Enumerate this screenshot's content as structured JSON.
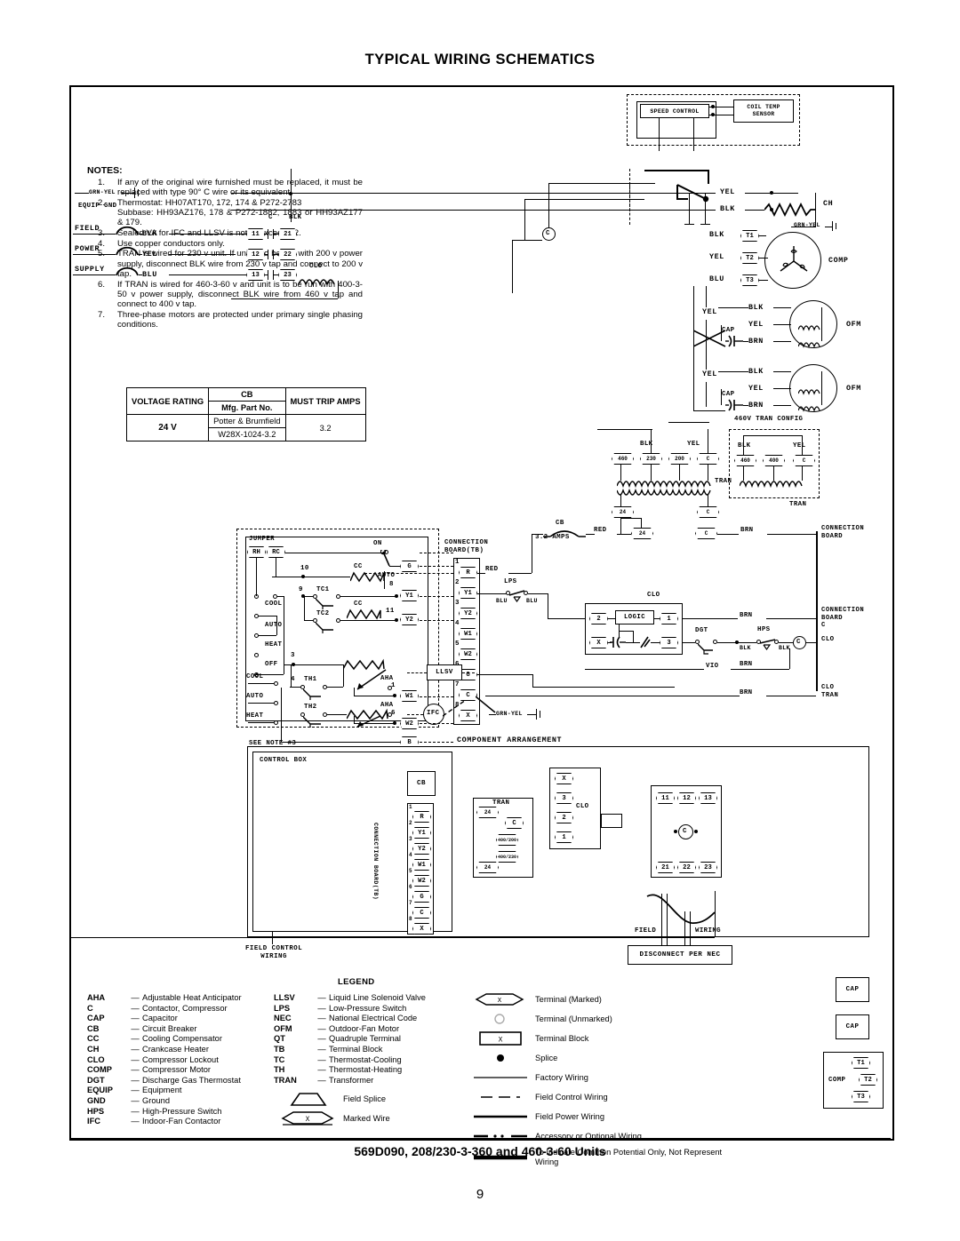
{
  "page_title": "TYPICAL WIRING SCHEMATICS",
  "footer_title": "569D090, 208/230-3-360 and 460-3-60 Units",
  "page_number": "9",
  "notes": {
    "heading": "NOTES:",
    "items": [
      {
        "num": "1.",
        "text": "If any of the original wire furnished must be replaced, it must be replaced with type 90° C wire or its equivalent."
      },
      {
        "num": "2.",
        "text": "Thermostat: HH07AT170, 172, 174 & P272-2783",
        "sub": "Subbase: HH93AZ176, 178 & P272-1882, 1883 or HH93AZ177 & 179."
      },
      {
        "num": "3.",
        "text": "Sealed VA for IFC and LLSV is not to exceed 22."
      },
      {
        "num": "4.",
        "text": "Use copper conductors only."
      },
      {
        "num": "5.",
        "text": "TRAN is wired for 230 v unit. If unit is to be run with 200 v power supply, disconnect BLK wire from 230 v tap and connect to 200 v tap."
      },
      {
        "num": "6.",
        "text": "If TRAN is wired for 460-3-60 v and unit is to be run with 400-3-50 v power supply, disconnect BLK wire from 460 v tap and connect to 400 v tap."
      },
      {
        "num": "7.",
        "text": "Three-phase motors are protected under primary single phasing conditions."
      }
    ]
  },
  "cb_table": {
    "col1_header": "VOLTAGE RATING",
    "col2_header": "CB",
    "col2_subheader": "Mfg. Part No.",
    "col3_header": "MUST TRIP AMPS",
    "voltage_value": "24 V",
    "mfg_name": "Potter & Brumfield",
    "mfg_part": "W28X-1024-3.2",
    "trip_amps": "3.2"
  },
  "schematic": {
    "speed_control": "SPEED CONTROL",
    "coil_temp_sensor": "COIL TEMP\nSENSOR",
    "equip_gnd": "EQUIP GND",
    "grn_yel": "GRN-YEL",
    "field": "FIELD",
    "power": "POWER",
    "supply": "SUPPLY",
    "ch": "CH",
    "comp": "COMP",
    "ofm": "OFM",
    "cap": "CAP",
    "tran": "TRAN",
    "tran_config_460": "460V TRAN CONFIG",
    "connection_board": "CONNECTION\nBOARD",
    "connection_board_c": "CONNECTION\nBOARD\nC",
    "clo": "CLO",
    "clo_tran": "CLO\nTRAN",
    "logic": "LOGIC",
    "dgt": "DGT",
    "hps": "HPS",
    "lps": "LPS",
    "cb": "CB",
    "cb_amps": "3.2 AMPS",
    "llsv": "LLSV",
    "ifc": "IFC",
    "jumper": "JUMPER",
    "on": "ON",
    "auto": "AUTO",
    "cool": "COOL",
    "heat": "HEAT",
    "off": "OFF",
    "cc": "CC",
    "aha": "AHA",
    "tc1": "TC1",
    "tc2": "TC2",
    "th1": "TH1",
    "th2": "TH2",
    "see_note": "SEE NOTE #3",
    "connection_board_tb": "CONNECTION\nBOARD(TB)",
    "component_arrangement": "COMPONENT ARRANGEMENT",
    "control_box": "CONTROL BOX",
    "connection_board_tb_vert": "CONNECTION BOARD(TB)",
    "field_control_wiring": "FIELD CONTROL\nWIRING",
    "field_wiring_left": "FIELD",
    "field_wiring_right": "WIRING",
    "disconnect_per_nec": "DISCONNECT PER NEC",
    "wire_colors": {
      "blk": "BLK",
      "yel": "YEL",
      "blu": "BLU",
      "brn": "BRN",
      "red": "RED",
      "vio": "VIO"
    },
    "tran_taps": [
      "460",
      "230",
      "200",
      "C"
    ],
    "tran_taps_460": [
      "460",
      "400",
      "C"
    ],
    "tran_sec": [
      "24",
      "C"
    ],
    "tran_arr_taps": [
      "400/200",
      "400/230"
    ],
    "line_terminals_top": [
      "11",
      "12",
      "13"
    ],
    "line_terminals_bot": [
      "21",
      "22",
      "23"
    ],
    "comp_terminals": [
      "T1",
      "T2",
      "T3"
    ],
    "contactor_c": "C",
    "tb_numbers": [
      "1",
      "2",
      "3",
      "4",
      "5",
      "6",
      "7",
      "8"
    ],
    "tb_terminals": [
      "R",
      "Y1",
      "Y2",
      "W1",
      "W2",
      "G",
      "C",
      "X"
    ],
    "clo_terminals": [
      "X",
      "3",
      "2",
      "1"
    ],
    "stat_terminals": [
      "G",
      "Y1",
      "Y2",
      "W1",
      "W2",
      "B"
    ],
    "stat_rh": "RH",
    "stat_rc": "RC",
    "stat_numbers": [
      "10",
      "9",
      "8",
      "11",
      "3",
      "4",
      "1",
      "6"
    ]
  },
  "legend": {
    "title": "LEGEND",
    "col1": [
      {
        "abbr": "AHA",
        "desc": "Adjustable Heat Anticipator"
      },
      {
        "abbr": "C",
        "desc": "Contactor, Compressor"
      },
      {
        "abbr": "CAP",
        "desc": "Capacitor"
      },
      {
        "abbr": "CB",
        "desc": "Circuit Breaker"
      },
      {
        "abbr": "CC",
        "desc": "Cooling Compensator"
      },
      {
        "abbr": "CH",
        "desc": "Crankcase Heater"
      },
      {
        "abbr": "CLO",
        "desc": "Compressor Lockout"
      },
      {
        "abbr": "COMP",
        "desc": "Compressor Motor"
      },
      {
        "abbr": "DGT",
        "desc": "Discharge Gas Thermostat"
      },
      {
        "abbr": "EQUIP",
        "desc": "Equipment"
      },
      {
        "abbr": "GND",
        "desc": "Ground"
      },
      {
        "abbr": "HPS",
        "desc": "High-Pressure Switch"
      },
      {
        "abbr": "IFC",
        "desc": "Indoor-Fan Contactor"
      }
    ],
    "col2": [
      {
        "abbr": "LLSV",
        "desc": "Liquid Line Solenoid Valve"
      },
      {
        "abbr": "LPS",
        "desc": "Low-Pressure Switch"
      },
      {
        "abbr": "NEC",
        "desc": "National Electrical Code"
      },
      {
        "abbr": "OFM",
        "desc": "Outdoor-Fan Motor"
      },
      {
        "abbr": "QT",
        "desc": "Quadruple Terminal"
      },
      {
        "abbr": "TB",
        "desc": "Terminal Block"
      },
      {
        "abbr": "TC",
        "desc": "Thermostat-Cooling"
      },
      {
        "abbr": "TH",
        "desc": "Thermostat-Heating"
      },
      {
        "abbr": "TRAN",
        "desc": "Transformer"
      }
    ],
    "col2_symbols": [
      {
        "symbol": "field-splice",
        "desc": "Field Splice"
      },
      {
        "symbol": "marked-wire",
        "desc": "Marked Wire",
        "mark": "X"
      }
    ],
    "col3_symbols": [
      {
        "symbol": "terminal-marked",
        "desc": "Terminal (Marked)",
        "mark": "X"
      },
      {
        "symbol": "terminal-unmarked",
        "desc": "Terminal (Unmarked)"
      },
      {
        "symbol": "terminal-block",
        "desc": "Terminal Block",
        "mark": "X"
      },
      {
        "symbol": "splice",
        "desc": "Splice"
      },
      {
        "symbol": "factory-wiring",
        "desc": "Factory Wiring"
      },
      {
        "symbol": "field-control-wiring",
        "desc": "Field Control Wiring"
      },
      {
        "symbol": "field-power-wiring",
        "desc": "Field Power Wiring"
      },
      {
        "symbol": "accessory-wiring",
        "desc": "Accessory or Optional Wiring"
      },
      {
        "symbol": "common-potential",
        "desc": "To Indicate Common Potential Only, Not Represent Wiring"
      }
    ]
  }
}
